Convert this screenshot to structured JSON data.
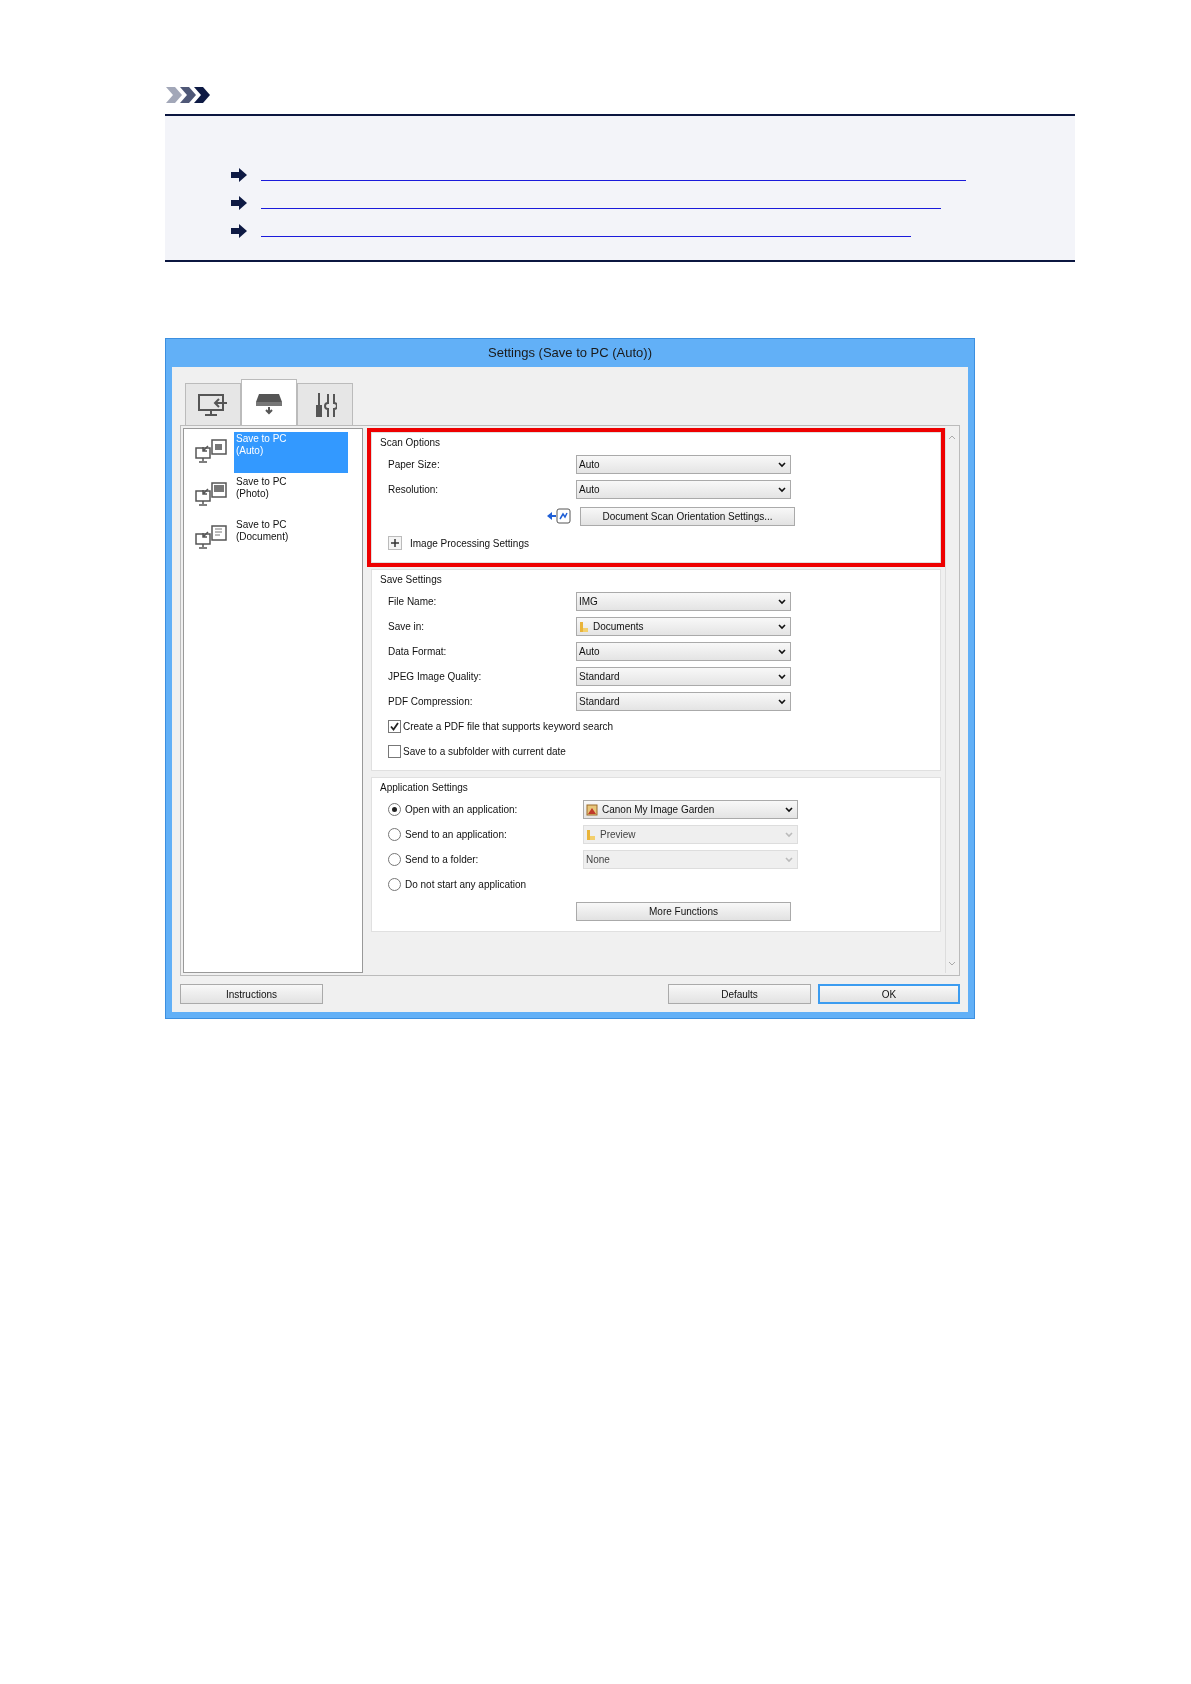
{
  "note": {
    "links": [
      {
        "kind": "link"
      },
      {
        "kind": "link"
      },
      {
        "kind": "link"
      }
    ]
  },
  "dialog": {
    "title": "Settings (Save to PC (Auto))",
    "tabs": [
      {
        "kind": "computer",
        "selected": false
      },
      {
        "kind": "scanner",
        "selected": true
      },
      {
        "kind": "tools",
        "selected": false
      }
    ],
    "sidebar": {
      "items": [
        {
          "label": "Save to PC (Auto)",
          "kind": "auto",
          "selected": true
        },
        {
          "label": "Save to PC (Photo)",
          "kind": "photo",
          "selected": false
        },
        {
          "label": "Save to PC (Document)",
          "kind": "document",
          "selected": false
        }
      ]
    },
    "scan_options": {
      "title": "Scan Options",
      "highlighted": true,
      "rows": [
        {
          "label": "Paper Size:",
          "value": "Auto"
        },
        {
          "label": "Resolution:",
          "value": "Auto"
        }
      ],
      "orientation_button": "Document Scan Orientation Settings...",
      "expander": {
        "label": "Image Processing Settings",
        "expanded": false
      }
    },
    "save_settings": {
      "title": "Save Settings",
      "rows": [
        {
          "label": "File Name:",
          "value": "IMG"
        },
        {
          "label": "Save in:",
          "value": "Documents",
          "kind": "folder"
        },
        {
          "label": "Data Format:",
          "value": "Auto"
        },
        {
          "label": "JPEG Image Quality:",
          "value": "Standard"
        },
        {
          "label": "PDF Compression:",
          "value": "Standard"
        }
      ],
      "checkboxes": [
        {
          "label": "Create a PDF file that supports keyword search",
          "checked": true
        },
        {
          "label": "Save to a subfolder with current date",
          "checked": false
        }
      ]
    },
    "application_settings": {
      "title": "Application Settings",
      "options": [
        {
          "label": "Open with an application:",
          "selected": true,
          "value": "Canon My Image Garden",
          "kind": "app",
          "disabled": false
        },
        {
          "label": "Send to an application:",
          "selected": false,
          "value": "Preview",
          "kind": "folder",
          "disabled": true
        },
        {
          "label": "Send to a folder:",
          "selected": false,
          "value": "None",
          "disabled": true
        },
        {
          "label": "Do not start any application",
          "selected": false
        }
      ],
      "more_button": "More Functions"
    },
    "buttons": [
      {
        "label": "Instructions",
        "default": false
      },
      {
        "label": "Defaults",
        "default": false
      },
      {
        "label": "OK",
        "default": true
      }
    ]
  }
}
